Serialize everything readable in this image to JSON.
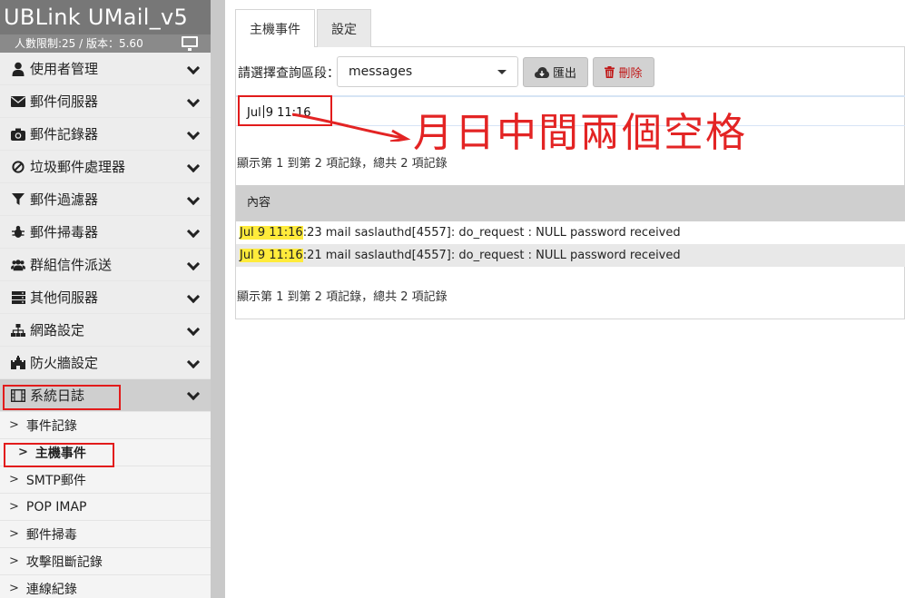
{
  "sidebar": {
    "brand": "UBLink UMail_v5",
    "subtitle": "人數限制:25 / 版本：5.60",
    "menu": [
      {
        "label": "使用者管理",
        "icon": "user-icon"
      },
      {
        "label": "郵件伺服器",
        "icon": "envelope-icon"
      },
      {
        "label": "郵件記錄器",
        "icon": "camera-icon"
      },
      {
        "label": "垃圾郵件處理器",
        "icon": "ban-icon"
      },
      {
        "label": "郵件過濾器",
        "icon": "filter-icon"
      },
      {
        "label": "郵件掃毒器",
        "icon": "bug-icon"
      },
      {
        "label": "群組信件派送",
        "icon": "users-icon"
      },
      {
        "label": "其他伺服器",
        "icon": "server-icon"
      },
      {
        "label": "網路設定",
        "icon": "sitemap-icon"
      },
      {
        "label": "防火牆設定",
        "icon": "castle-icon"
      },
      {
        "label": "系統日誌",
        "icon": "film-icon"
      }
    ],
    "submenu": [
      {
        "label": "事件記錄"
      },
      {
        "label": "主機事件"
      },
      {
        "label": "SMTP郵件"
      },
      {
        "label": "POP IMAP"
      },
      {
        "label": "郵件掃毒"
      },
      {
        "label": "攻擊阻斷記錄"
      },
      {
        "label": "連線紀錄"
      }
    ]
  },
  "tabs": [
    {
      "label": "主機事件"
    },
    {
      "label": "設定"
    }
  ],
  "query": {
    "label": "請選擇查詢區段：",
    "selected": "messages",
    "export_label": "匯出",
    "delete_label": "刪除"
  },
  "filter": {
    "value_before": "Jul",
    "value_after": "9 11:16"
  },
  "annotation": "月日中間兩個空格",
  "summary": "顯示第 1 到第 2 項記錄，總共 2 項記錄",
  "table": {
    "header": "內容",
    "rows": [
      {
        "highlight": "Jul 9 11:16",
        "rest": ":23 mail saslauthd[4557]: do_request : NULL password received"
      },
      {
        "highlight": "Jul 9 11:16",
        "rest": ":21 mail saslauthd[4557]: do_request : NULL password received"
      }
    ]
  },
  "colors": {
    "annotation_red": "#e32424",
    "highlight_yellow": "#ffeb3b",
    "delete_red": "#c01818"
  }
}
